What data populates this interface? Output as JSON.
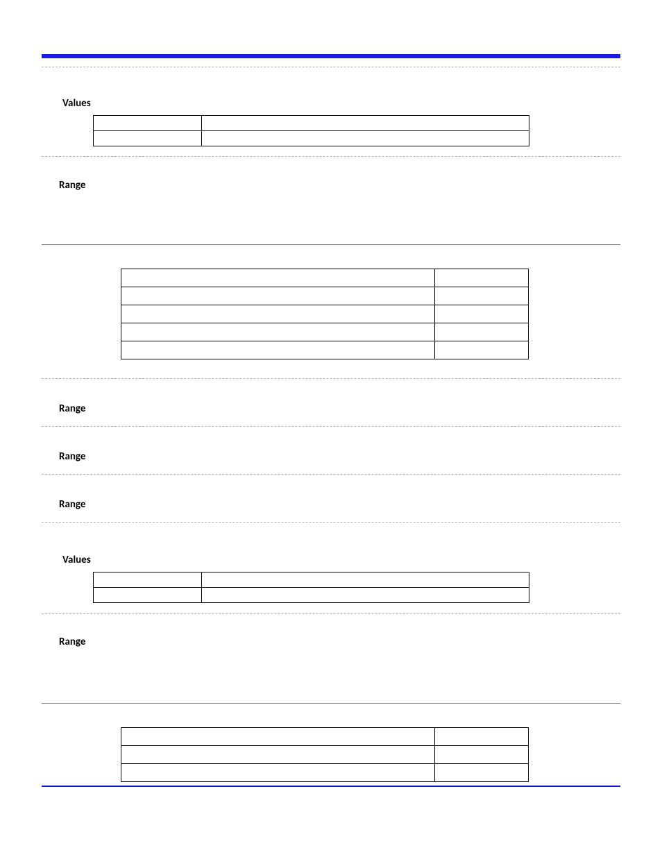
{
  "sections": {
    "values1": {
      "label": "Values"
    },
    "range1": {
      "label": "Range"
    },
    "range2": {
      "label": "Range"
    },
    "range3": {
      "label": "Range"
    },
    "range4": {
      "label": "Range"
    },
    "values2": {
      "label": "Values"
    },
    "range5": {
      "label": "Range"
    }
  }
}
